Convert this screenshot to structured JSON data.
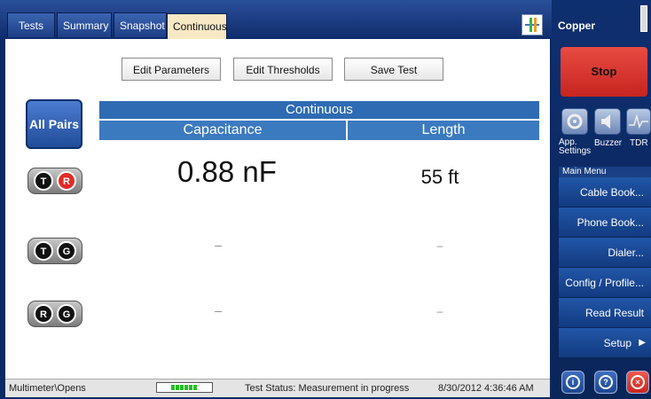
{
  "tabs": [
    {
      "label": "Tests"
    },
    {
      "label": "Summary"
    },
    {
      "label": "Snapshot"
    },
    {
      "label": "Continuous"
    }
  ],
  "toolbar": {
    "edit_parameters": "Edit Parameters",
    "edit_thresholds": "Edit Thresholds",
    "save_test": "Save Test"
  },
  "all_pairs_label": "All Pairs",
  "table": {
    "group_header": "Continuous",
    "col_capacitance": "Capacitance",
    "col_length": "Length",
    "rows": [
      {
        "pin1": "T",
        "pin2": "R",
        "capacitance": "0.88 nF",
        "length": "55 ft"
      },
      {
        "pin1": "T",
        "pin2": "G",
        "capacitance": "–",
        "length": "–"
      },
      {
        "pin1": "R",
        "pin2": "G",
        "capacitance": "–",
        "length": "–"
      }
    ]
  },
  "status": {
    "mode": "Multimeter\\Opens",
    "test_status": "Test Status: Measurement in progress",
    "datetime": "8/30/2012 4:36:46 AM"
  },
  "right_panel": {
    "title": "Copper",
    "stop_label": "Stop",
    "quick": [
      {
        "label": "App. Settings",
        "icon": "settings-icon"
      },
      {
        "label": "Buzzer",
        "icon": "speaker-icon"
      },
      {
        "label": "TDR",
        "icon": "tdr-icon"
      }
    ],
    "menu_title": "Main Menu",
    "menu_items": [
      {
        "label": "Cable Book..."
      },
      {
        "label": "Phone Book..."
      },
      {
        "label": "Dialer..."
      },
      {
        "label": "Config / Profile..."
      },
      {
        "label": "Read Result File..."
      },
      {
        "label": "Setup"
      }
    ]
  },
  "colors": {
    "accent_blue": "#2f6bb3",
    "stop_red": "#d8322b",
    "active_tab": "#f8e8c4"
  }
}
